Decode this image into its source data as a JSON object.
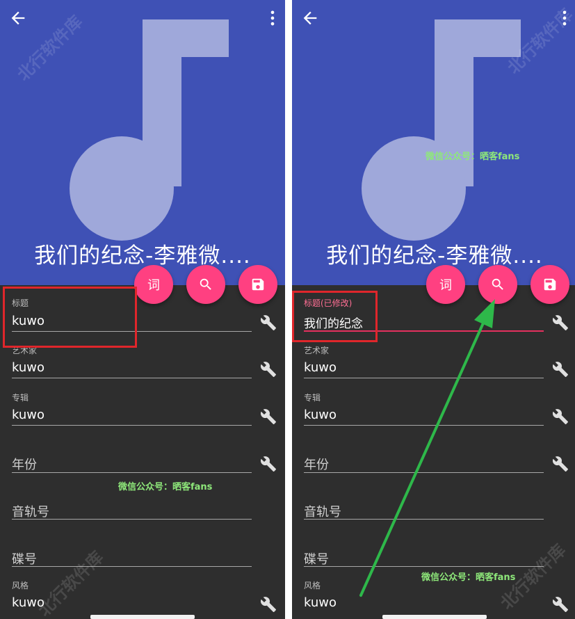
{
  "left": {
    "song_title": "我们的纪念-李雅微....",
    "fab_lyrics": "词",
    "fields": [
      {
        "label": "标题",
        "value": "kuwo"
      },
      {
        "label": "艺术家",
        "value": "kuwo"
      },
      {
        "label": "专辑",
        "value": "kuwo"
      },
      {
        "label": "",
        "placeholder": "年份"
      },
      {
        "label": "",
        "placeholder": "音轨号"
      },
      {
        "label": "",
        "placeholder": "碟号"
      },
      {
        "label": "风格",
        "value": "kuwo"
      }
    ],
    "watermark": "微信公众号：晒客fans"
  },
  "right": {
    "song_title": "我们的纪念-李雅微....",
    "fab_lyrics": "词",
    "fields": [
      {
        "label": "标题(已修改)",
        "value": "我们的纪念"
      },
      {
        "label": "艺术家",
        "value": "kuwo"
      },
      {
        "label": "专辑",
        "value": "kuwo"
      },
      {
        "label": "",
        "placeholder": "年份"
      },
      {
        "label": "",
        "placeholder": "音轨号"
      },
      {
        "label": "",
        "placeholder": "碟号"
      },
      {
        "label": "风格",
        "value": "kuwo"
      }
    ],
    "watermark_header": "微信公众号：晒客fans",
    "watermark_bottom": "微信公众号：晒客fans"
  },
  "site_watermark": "北行软件库",
  "colors": {
    "header": "#3f51b5",
    "note": "#9fa8da",
    "fab": "#ff4081",
    "body": "#2e2e2e",
    "highlight_box": "#e0262b",
    "arrow": "#2eb84a",
    "active_underline": "#e5305e"
  },
  "icons": [
    "back-arrow-icon",
    "more-vert-icon",
    "music-note-icon",
    "search-icon",
    "save-icon",
    "wrench-icon"
  ]
}
